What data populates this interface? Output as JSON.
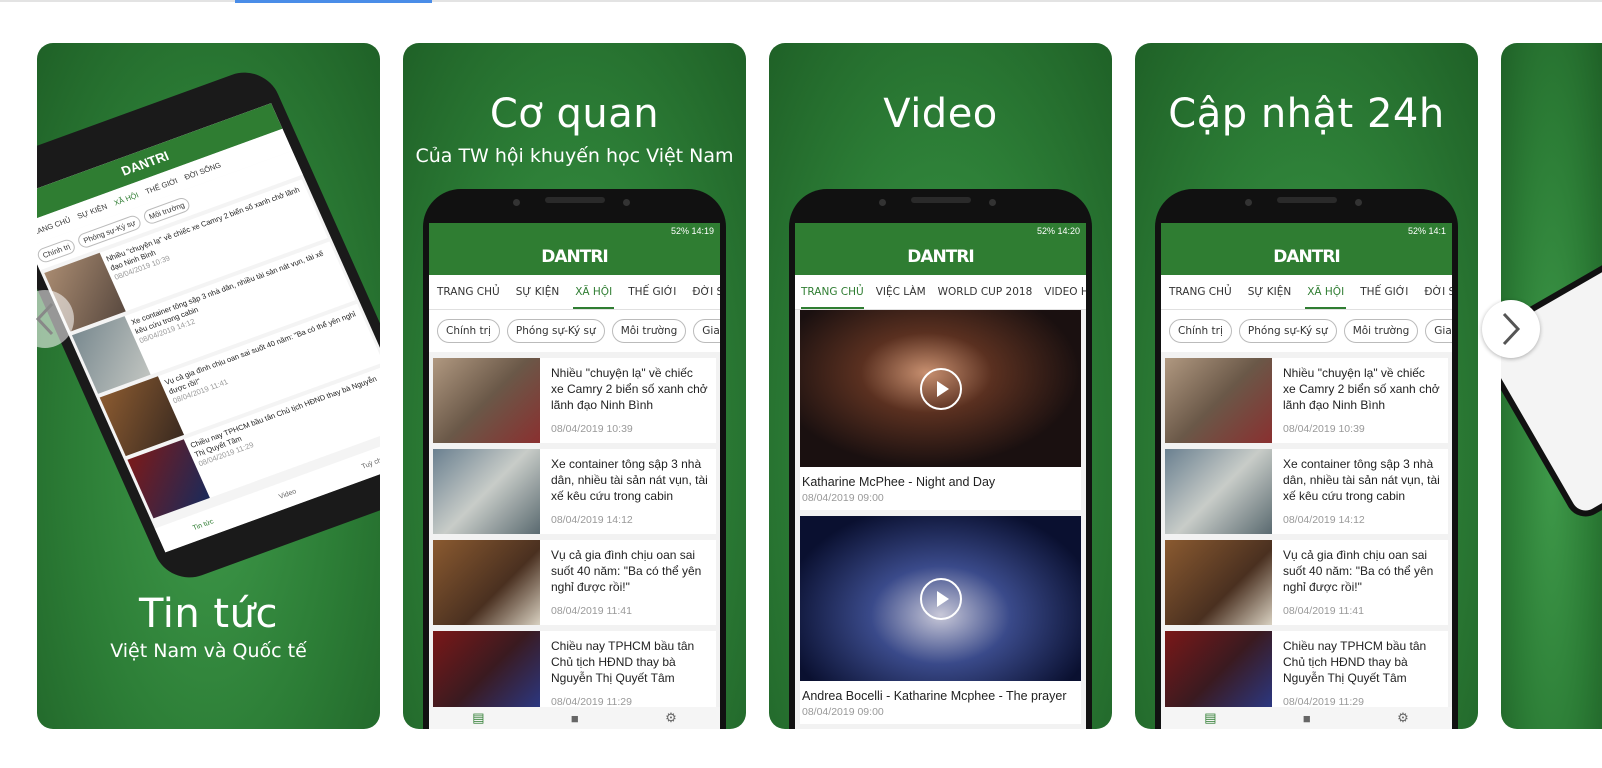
{
  "colors": {
    "accent": "#2f7d32",
    "card_bg": "#2c7d36",
    "progress": "#4a8de8"
  },
  "cards": [
    {
      "title": "Tin tức",
      "subtitle": "Việt Nam và Quốc tế"
    },
    {
      "title": "Cơ quan",
      "subtitle": "Của TW hội khuyến học Việt Nam"
    },
    {
      "title": "Video",
      "subtitle": ""
    },
    {
      "title": "Cập nhật 24h",
      "subtitle": ""
    }
  ],
  "app": {
    "logo": "DANTRI",
    "status_time_1": "14:19",
    "status_time_2": "14:20",
    "status_time_4": "14:1",
    "battery": "52%",
    "tabs_news": [
      "TRANG CHỦ",
      "SỰ KIỆN",
      "XÃ HỘI",
      "THẾ GIỚI",
      "ĐỜI SỐNG"
    ],
    "tabs_video": [
      "TRANG CHỦ",
      "VIỆC LÀM",
      "WORLD CUP 2018",
      "VIDEO HOT"
    ],
    "chips": [
      "Chính trị",
      "Phóng sự-Ký sự",
      "Môi trường",
      "Giao thôn"
    ],
    "articles": [
      {
        "title": "Nhiều \"chuyện lạ\" về chiếc xe Camry 2 biển số xanh chở lãnh đạo Ninh Bình",
        "time": "08/04/2019 10:39"
      },
      {
        "title": "Xe container tông sập 3 nhà dân, nhiều tài sản nát vụn, tài xế kêu cứu trong cabin",
        "time": "08/04/2019 14:12"
      },
      {
        "title": "Vụ cả gia đình chịu oan sai suốt 40 năm: \"Ba có thể yên nghỉ được rồi!\"",
        "time": "08/04/2019 11:41"
      },
      {
        "title": "Chiều nay TPHCM bầu tân Chủ tịch HĐND thay bà Nguyễn Thị Quyết Tâm",
        "time": "08/04/2019 11:29"
      }
    ],
    "videos": [
      {
        "title": "Katharine McPhee - Night and Day",
        "time": "08/04/2019 09:00"
      },
      {
        "title": "Andrea Bocelli - Katharine Mcphee - The prayer",
        "time": "08/04/2019 09:00"
      }
    ],
    "tilted_nav": [
      "Tin tức",
      "Video",
      "Tuỳ chỉnh"
    ]
  }
}
